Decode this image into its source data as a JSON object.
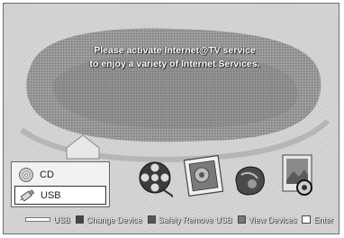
{
  "message": {
    "line1": "Please activate Internet@TV service",
    "line2": "to enjoy a variety of Internet Services."
  },
  "device_list": {
    "items": [
      {
        "label": "CD",
        "icon": "disc-icon",
        "selected": false
      },
      {
        "label": "USB",
        "icon": "usb-icon",
        "selected": true
      }
    ]
  },
  "apps": [
    {
      "icon": "film-reel-icon"
    },
    {
      "icon": "photo-icon"
    },
    {
      "icon": "music-icon"
    },
    {
      "icon": "settings-icon"
    }
  ],
  "bottom_bar": {
    "usb_label": "USB",
    "change_device": "Change Device",
    "safely_remove": "Safely Remove USB",
    "view_devices": "View Devices",
    "enter": "Enter"
  }
}
